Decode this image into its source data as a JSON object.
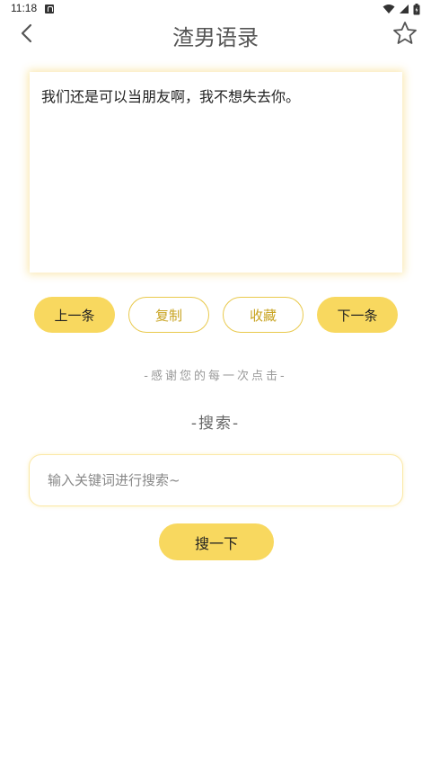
{
  "status_bar": {
    "time": "11:18",
    "icons": [
      "notification-a-icon",
      "wifi-icon",
      "signal-icon",
      "battery-icon"
    ]
  },
  "header": {
    "title": "渣男语录",
    "back_icon": "chevron-left-icon",
    "favorite_icon": "star-outline-icon"
  },
  "quote": {
    "text": "我们还是可以当朋友啊，我不想失去你。"
  },
  "actions": {
    "prev_label": "上一条",
    "copy_label": "复制",
    "collect_label": "收藏",
    "next_label": "下一条"
  },
  "thanks_text": "-感谢您的每一次点击-",
  "search": {
    "title": "-搜索-",
    "placeholder": "输入关键词进行搜索~",
    "value": "",
    "button_label": "搜一下"
  },
  "colors": {
    "accent": "#f8d85f",
    "accent_border": "#e9c94c",
    "accent_text": "#c8a320",
    "card_glow": "#f5cd50"
  }
}
